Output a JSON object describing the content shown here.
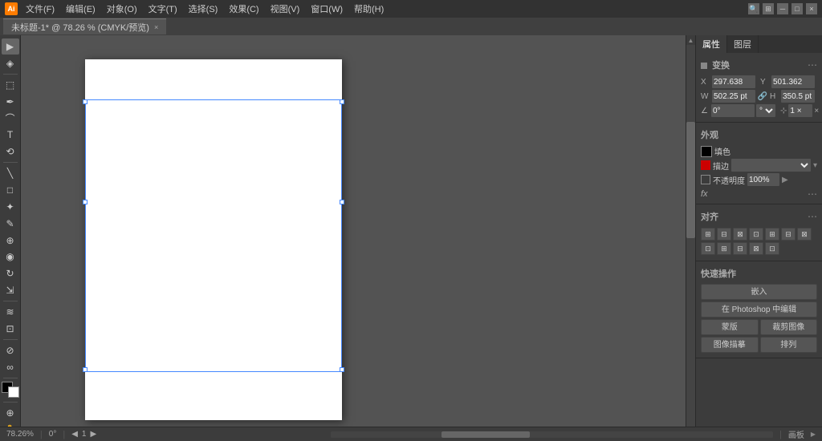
{
  "titlebar": {
    "ai_label": "Ai",
    "menus": [
      "文件(F)",
      "编辑(E)",
      "对象(O)",
      "文字(T)",
      "选择(S)",
      "效果(C)",
      "视图(V)",
      "窗口(W)",
      "帮助(H)"
    ],
    "tab_label": "未标题-1* @ 78.26 % (CMYK/预览)",
    "close_tab": "×"
  },
  "panels": {
    "tabs": [
      "属性",
      "图层"
    ],
    "transform_title": "变换",
    "x_label": "X",
    "y_label": "Y",
    "w_label": "W",
    "h_label": "H",
    "x_val": "297.638",
    "y_val": "501.362",
    "w_val": "502.25 pt",
    "h_val": "350.5 pt",
    "angle_val": "0°",
    "shear_val": "1 ×",
    "appearance_title": "外观",
    "fill_label": "填色",
    "stroke_label": "描边",
    "opacity_label": "不透明度",
    "opacity_val": "100%",
    "fx_label": "fx",
    "align_title": "对齐",
    "quick_actions_title": "快速操作",
    "btn_embed": "嵌入",
    "btn_edit_ps": "在 Photoshop 中编辑",
    "btn_home": "蒙版",
    "btn_preview": "裁剪图像",
    "btn_trace": "图像描摹",
    "btn_arrange": "排列",
    "align_btns": [
      "⬛",
      "⬛",
      "⬛",
      "⬛",
      "⬛",
      "⬛",
      "⬛",
      "⬛",
      "⬛",
      "⬛",
      "⬛",
      "⬛"
    ]
  },
  "statusbar": {
    "zoom": "78.26%",
    "angle": "0°",
    "pages": "1",
    "status_text": "画板"
  },
  "tools": [
    "▶",
    "◈",
    "⬚",
    "✏",
    "⌨",
    "⬡",
    "∥",
    "✂",
    "◱",
    "🔍",
    "⬤",
    "⬡",
    "✦",
    "⊕",
    "◉",
    "∫",
    "🔵",
    "≡",
    "⬛",
    "🖐"
  ]
}
